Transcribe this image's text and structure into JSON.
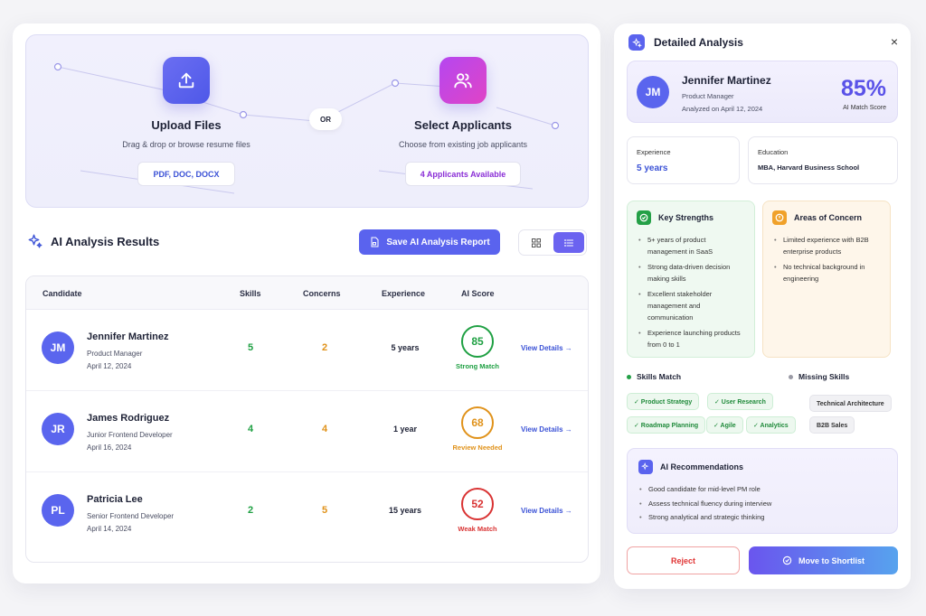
{
  "upload": {
    "upload_title": "Upload Files",
    "upload_subtitle": "Drag & drop or browse resume files",
    "file_types": "PDF, DOC, DOCX",
    "or_label": "OR",
    "select_title": "Select Applicants",
    "select_subtitle": "Choose from existing job applicants",
    "available": "4 Applicants Available"
  },
  "results": {
    "title": "AI Analysis Results",
    "save_label": "Save AI Analysis Report",
    "columns": [
      "Candidate",
      "Skills",
      "Concerns",
      "Experience",
      "AI Score"
    ],
    "view_details": "View Details →",
    "rows": [
      {
        "initials": "JM",
        "name": "Jennifer Martinez",
        "role": "Product Manager",
        "date": "April 12, 2024",
        "skills": "5",
        "concerns": "2",
        "experience": "5 years",
        "score": "85",
        "label": "Strong Match",
        "color": "#1fa043"
      },
      {
        "initials": "JR",
        "name": "James Rodriguez",
        "role": "Junior Frontend Developer",
        "date": "April 16, 2024",
        "skills": "4",
        "concerns": "4",
        "experience": "1 year",
        "score": "68",
        "label": "Review Needed",
        "color": "#e0921a"
      },
      {
        "initials": "PL",
        "name": "Patricia Lee",
        "role": "Senior Frontend Developer",
        "date": "April 14, 2024",
        "skills": "2",
        "concerns": "5",
        "experience": "15 years",
        "score": "52",
        "label": "Weak Match",
        "color": "#d93333"
      }
    ]
  },
  "detail": {
    "title": "Detailed Analysis",
    "close": "×",
    "initials": "JM",
    "name": "Jennifer Martinez",
    "role": "Product Manager",
    "analyzed": "Analyzed on April 12, 2024",
    "score": "85%",
    "score_label": "AI Match Score",
    "experience_label": "Experience",
    "experience_value": "5 years",
    "education_label": "Education",
    "education_value": "MBA, Harvard Business School",
    "strengths_title": "Key Strengths",
    "strengths": [
      "5+ years of product management in SaaS",
      "Strong data-driven decision making skills",
      "Excellent stakeholder management and communication",
      "Experience launching products from 0 to 1"
    ],
    "concerns_title": "Areas of Concern",
    "concerns": [
      "Limited experience with B2B enterprise products",
      "No technical background in engineering"
    ],
    "skills_match_title": "Skills Match",
    "skills_match": [
      "✓ Product Strategy",
      "✓ User Research",
      "✓ Roadmap Planning",
      "✓ Agile",
      "✓ Analytics"
    ],
    "missing_title": "Missing Skills",
    "missing": [
      "Technical Architecture",
      "B2B Sales"
    ],
    "rec_title": "AI Recommendations",
    "recs": [
      "Good candidate for mid-level PM role",
      "Assess technical fluency during interview",
      "Strong analytical and strategic thinking"
    ],
    "reject_label": "Reject",
    "shortlist_label": "Move to Shortlist"
  },
  "colors": {
    "accent": "#5a63ee",
    "green": "#1fa043",
    "orange": "#e0921a",
    "red": "#d93333"
  }
}
